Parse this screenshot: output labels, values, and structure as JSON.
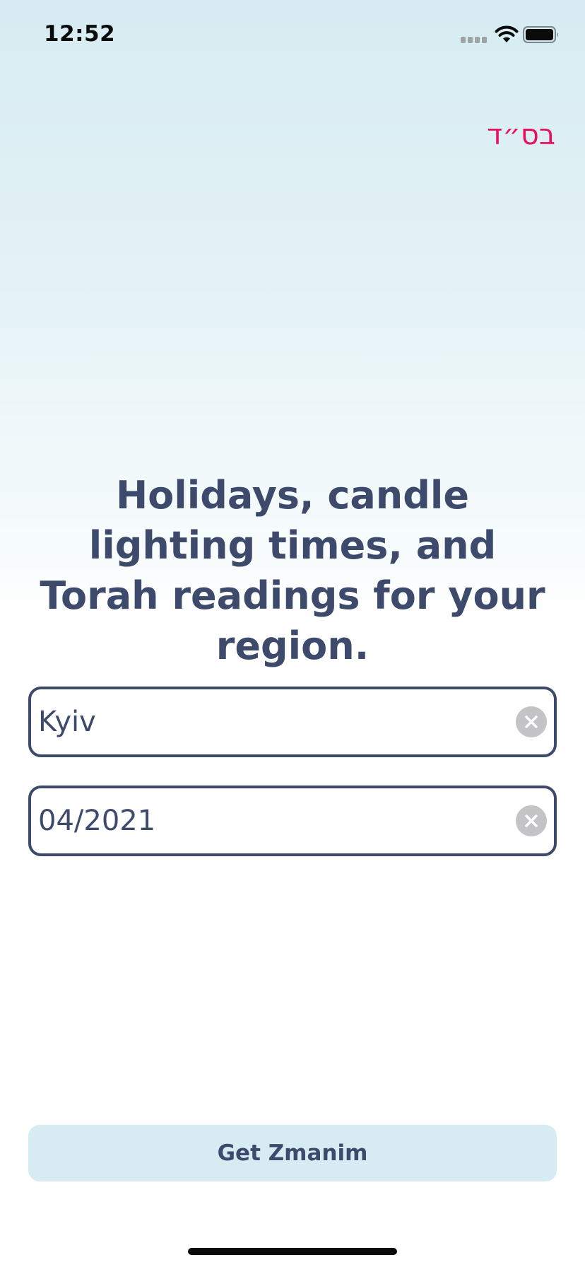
{
  "status_bar": {
    "time": "12:52",
    "icons": [
      "signal-icon",
      "wifi-icon",
      "battery-icon"
    ]
  },
  "header": {
    "hebrew_mark": "בס״ד",
    "hebrew_mark_color": "#e8125c"
  },
  "main": {
    "headline": "Holidays, candle lighting times, and Torah readings for your region.",
    "location_field": {
      "value": "Kyiv",
      "clear_icon": "clear-circle-x-icon"
    },
    "date_field": {
      "value": "04/2021",
      "clear_icon": "clear-circle-x-icon"
    },
    "submit_button": {
      "label": "Get Zmanim"
    }
  },
  "colors": {
    "text": "#3e4a6b",
    "accent": "#e8125c",
    "button_bg": "#d6ebf2",
    "background_top": "#d6ecf2"
  }
}
